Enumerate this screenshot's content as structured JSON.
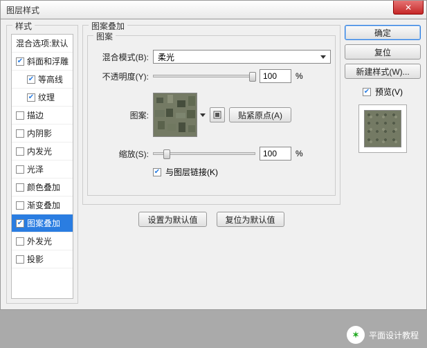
{
  "window": {
    "title": "图层样式",
    "close": "✕"
  },
  "sidebar": {
    "legend": "样式",
    "items": [
      {
        "label": "混合选项:默认",
        "checked": null,
        "sub": false,
        "selected": false
      },
      {
        "label": "斜面和浮雕",
        "checked": true,
        "sub": false,
        "selected": false
      },
      {
        "label": "等高线",
        "checked": true,
        "sub": true,
        "selected": false
      },
      {
        "label": "纹理",
        "checked": true,
        "sub": true,
        "selected": false
      },
      {
        "label": "描边",
        "checked": false,
        "sub": false,
        "selected": false
      },
      {
        "label": "内阴影",
        "checked": false,
        "sub": false,
        "selected": false
      },
      {
        "label": "内发光",
        "checked": false,
        "sub": false,
        "selected": false
      },
      {
        "label": "光泽",
        "checked": false,
        "sub": false,
        "selected": false
      },
      {
        "label": "颜色叠加",
        "checked": false,
        "sub": false,
        "selected": false
      },
      {
        "label": "渐变叠加",
        "checked": false,
        "sub": false,
        "selected": false
      },
      {
        "label": "图案叠加",
        "checked": true,
        "sub": false,
        "selected": true
      },
      {
        "label": "外发光",
        "checked": false,
        "sub": false,
        "selected": false
      },
      {
        "label": "投影",
        "checked": false,
        "sub": false,
        "selected": false
      }
    ]
  },
  "panel": {
    "legend_outer": "图案叠加",
    "legend_inner": "图案",
    "blend_label": "混合模式(B):",
    "blend_value": "柔光",
    "opacity_label": "不透明度(Y):",
    "opacity_value": "100",
    "pattern_label": "图案:",
    "snap_label": "贴紧原点(A)",
    "scale_label": "缩放(S):",
    "scale_value": "100",
    "percent": "%",
    "link_label": "与图层链接(K)",
    "link_checked": true,
    "set_default": "设置为默认值",
    "reset_default": "复位为默认值"
  },
  "right": {
    "ok": "确定",
    "cancel": "复位",
    "new_style": "新建样式(W)...",
    "preview_label": "预览(V)",
    "preview_checked": true
  },
  "caption": "平面设计教程"
}
